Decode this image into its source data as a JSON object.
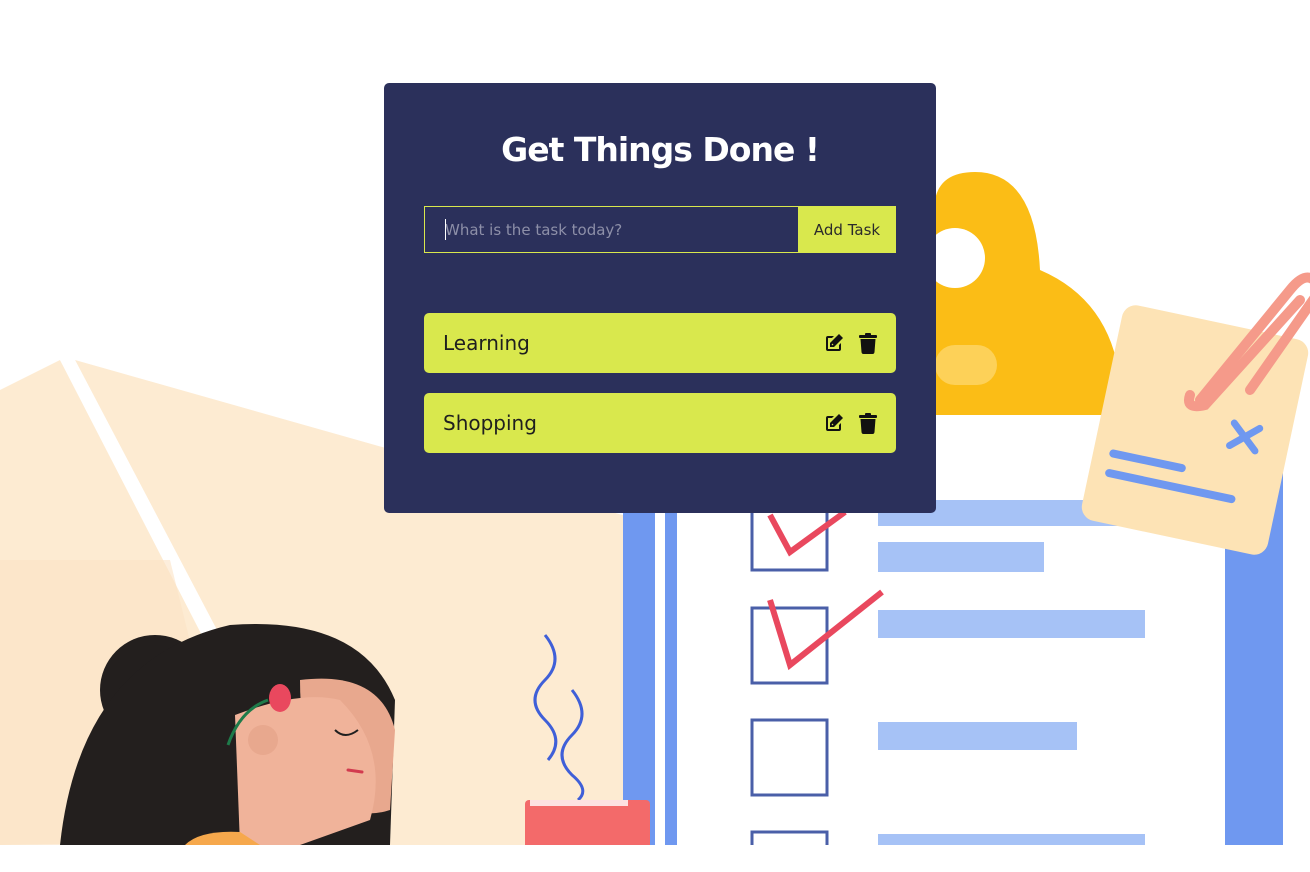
{
  "app": {
    "title": "Get Things Done !",
    "input_placeholder": "What is the task today?",
    "input_value": "",
    "add_button_label": "Add Task"
  },
  "todos": [
    {
      "label": "Learning"
    },
    {
      "label": "Shopping"
    }
  ],
  "colors": {
    "card_bg": "#2b305b",
    "accent": "#d9e84d",
    "title_text": "#ffffff"
  },
  "icons": {
    "edit": "edit-icon",
    "delete": "trash-icon"
  }
}
